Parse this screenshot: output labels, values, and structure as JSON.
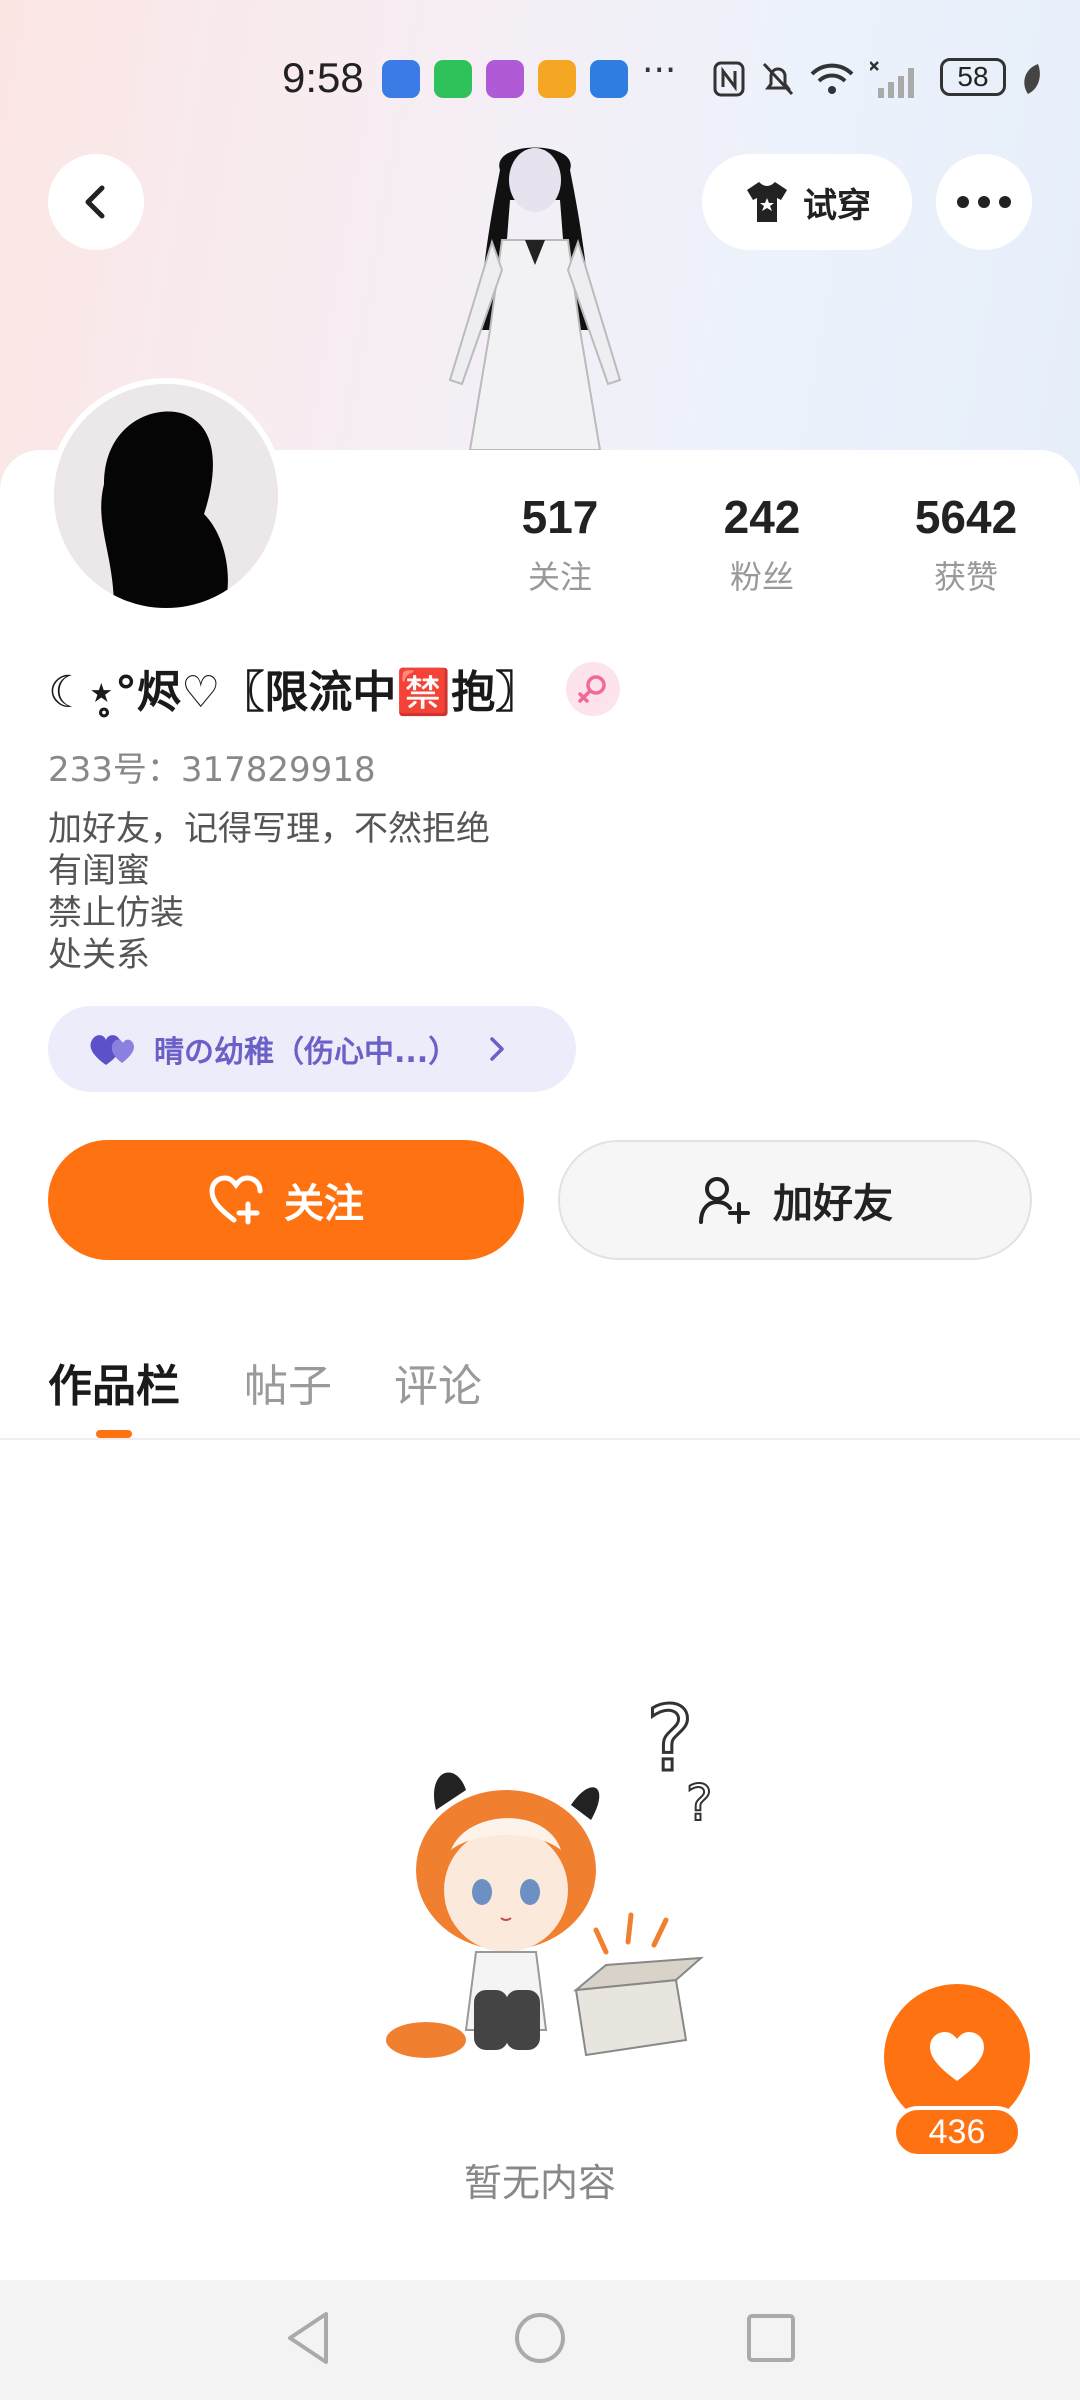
{
  "status_bar": {
    "time": "9:58",
    "more": "···",
    "battery": "58"
  },
  "header": {
    "try_on_label": "试穿"
  },
  "profile": {
    "stats": [
      {
        "value": "517",
        "label": "关注"
      },
      {
        "value": "242",
        "label": "粉丝"
      },
      {
        "value": "5642",
        "label": "获赞"
      }
    ],
    "name": "☾⋆̥°烬♡〖限流中🈲抱〗",
    "uid": "233号：317829918",
    "bio": [
      "加好友，记得写理，不然拒绝",
      "有闺蜜",
      "禁止仿装",
      "处关系"
    ],
    "relation_tag": "晴の幼稚（伤心中...）"
  },
  "actions": {
    "follow_label": "关注",
    "add_friend_label": "加好友"
  },
  "tabs": [
    {
      "label": "作品栏",
      "active": true
    },
    {
      "label": "帖子",
      "active": false
    },
    {
      "label": "评论",
      "active": false
    }
  ],
  "empty_state": {
    "text": "暂无内容"
  },
  "like_fab": {
    "count": "436"
  },
  "colors": {
    "accent": "#ff7212",
    "tag_text": "#6a60c6",
    "tag_bg": "#ececfb"
  }
}
